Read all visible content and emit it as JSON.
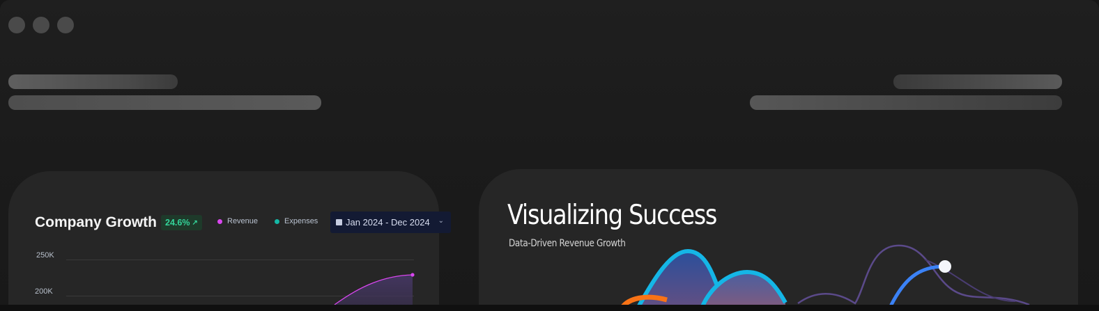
{
  "window": {
    "controls": [
      "close",
      "minimize",
      "maximize"
    ]
  },
  "company_growth": {
    "title": "Company Growth",
    "badge": "24.6%",
    "badge_icon": "arrow-up-right-icon",
    "legend": [
      {
        "label": "Revenue",
        "color": "#d946ef"
      },
      {
        "label": "Expenses",
        "color": "#14b8a6"
      }
    ],
    "date_range": "Jan 2024 - Dec 2024",
    "date_icon": "calendar-icon",
    "dropdown_icon": "chevron-down-icon",
    "y_ticks": [
      "250K",
      "200K"
    ]
  },
  "visualizing": {
    "title": "Visualizing Success",
    "subtitle": "Data-Driven Revenue Growth"
  },
  "colors": {
    "revenue": "#d946ef",
    "expenses": "#14b8a6",
    "positive": "#34d399",
    "accent_blue": "#3b82f6",
    "accent_cyan": "#06b6d4",
    "accent_orange": "#f97316"
  }
}
